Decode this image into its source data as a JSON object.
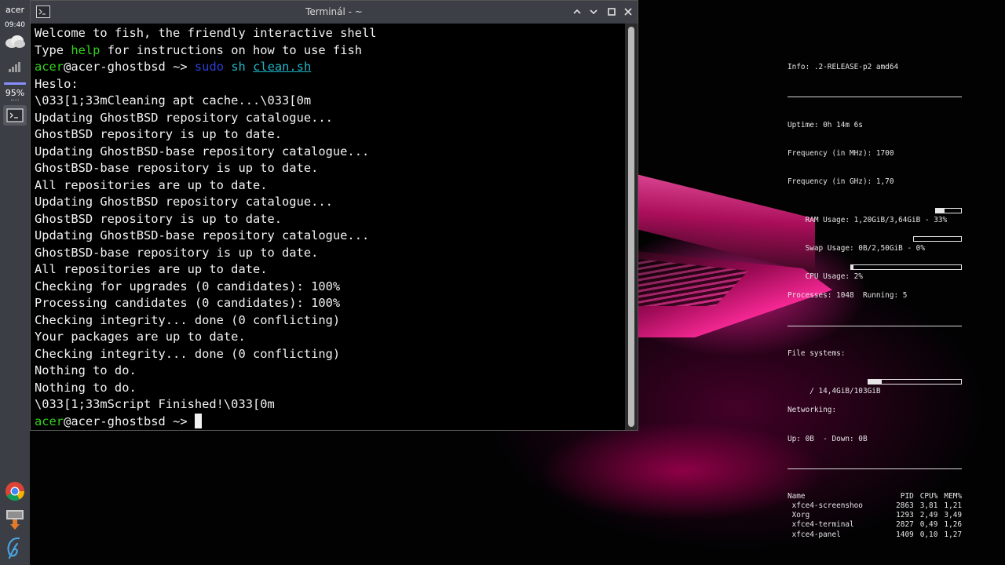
{
  "panel": {
    "user": "acer",
    "clock": "09:40",
    "battery": "95%"
  },
  "window": {
    "title": "Terminál - ~"
  },
  "terminal": {
    "line1": "Welcome to fish, the friendly interactive shell",
    "line2_pre": "Type ",
    "line2_kw": "help",
    "line2_post": " for instructions on how to use fish",
    "prompt_user": "acer",
    "prompt_host": "@acer-ghostbsd",
    "prompt_dir": " ~",
    "prompt_sym": "> ",
    "cmd1": "sudo",
    "cmd2": "sh",
    "cmd3": "clean.sh",
    "output": [
      "Heslo:",
      "\\033[1;33mCleaning apt cache...\\033[0m",
      "Updating GhostBSD repository catalogue...",
      "GhostBSD repository is up to date.",
      "Updating GhostBSD-base repository catalogue...",
      "GhostBSD-base repository is up to date.",
      "All repositories are up to date.",
      "Updating GhostBSD repository catalogue...",
      "GhostBSD repository is up to date.",
      "Updating GhostBSD-base repository catalogue...",
      "GhostBSD-base repository is up to date.",
      "All repositories are up to date.",
      "Checking for upgrades (0 candidates): 100%",
      "Processing candidates (0 candidates): 100%",
      "Checking integrity... done (0 conflicting)",
      "Your packages are up to date.",
      "Checking integrity... done (0 conflicting)",
      "Nothing to do.",
      "Nothing to do.",
      "\\033[1;33mScript Finished!\\033[0m"
    ]
  },
  "conky": {
    "info": "Info: .2-RELEASE-p2 amd64",
    "uptime": "Uptime: 0h 14m 6s",
    "freq_mhz": "Frequency (in MHz): 1700",
    "freq_ghz": "Frequency (in GHz): 1,70",
    "ram": "RAM Usage: 1,20GiB/3,64GiB - 33%",
    "ram_level": 0.33,
    "swap": "Swap Usage: 0B/2,50GiB - 0%",
    "swap_level": 0,
    "cpu": "CPU Usage: 2%",
    "cpu_level": 0.02,
    "processes": "Processes: 1048  Running: 5",
    "fs_label": "File systems:",
    "fs_root": " / 14,4GiB/103GiB",
    "fs_level": 0.14,
    "net_label": "Networking:",
    "net": "Up: 0B  - Down: 0B",
    "proc_headers": [
      "Name",
      "PID",
      "CPU%",
      "MEM%"
    ],
    "procs": [
      {
        "name": " xfce4-screenshoo",
        "pid": "2863",
        "cpu": "3,81",
        "mem": "1,21"
      },
      {
        "name": " Xorg",
        "pid": "1293",
        "cpu": "2,49",
        "mem": "3,49"
      },
      {
        "name": " xfce4-terminal",
        "pid": "2827",
        "cpu": "0,49",
        "mem": "1,26"
      },
      {
        "name": " xfce4-panel",
        "pid": "1409",
        "cpu": "0,10",
        "mem": "1,27"
      }
    ]
  }
}
